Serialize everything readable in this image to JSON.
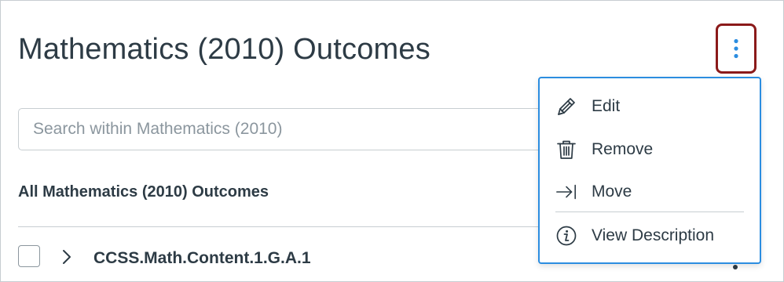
{
  "header": {
    "title": "Mathematics (2010) Outcomes"
  },
  "search": {
    "placeholder": "Search within Mathematics (2010)",
    "value": ""
  },
  "section": {
    "heading": "All Mathematics (2010) Outcomes"
  },
  "outcomes": [
    {
      "title": "CCSS.Math.Content.1.G.A.1",
      "checked": false
    }
  ],
  "menu": {
    "items": [
      {
        "label": "Edit",
        "icon": "pencil-icon"
      },
      {
        "label": "Remove",
        "icon": "trash-icon"
      },
      {
        "label": "Move",
        "icon": "move-arrow-icon"
      },
      {
        "label": "View Description",
        "icon": "info-icon"
      }
    ]
  },
  "colors": {
    "text": "#2d3b45",
    "focus_ring": "#2b8de0",
    "highlight_border": "#8b1a1a",
    "kebab_dots": "#2b8de0"
  }
}
